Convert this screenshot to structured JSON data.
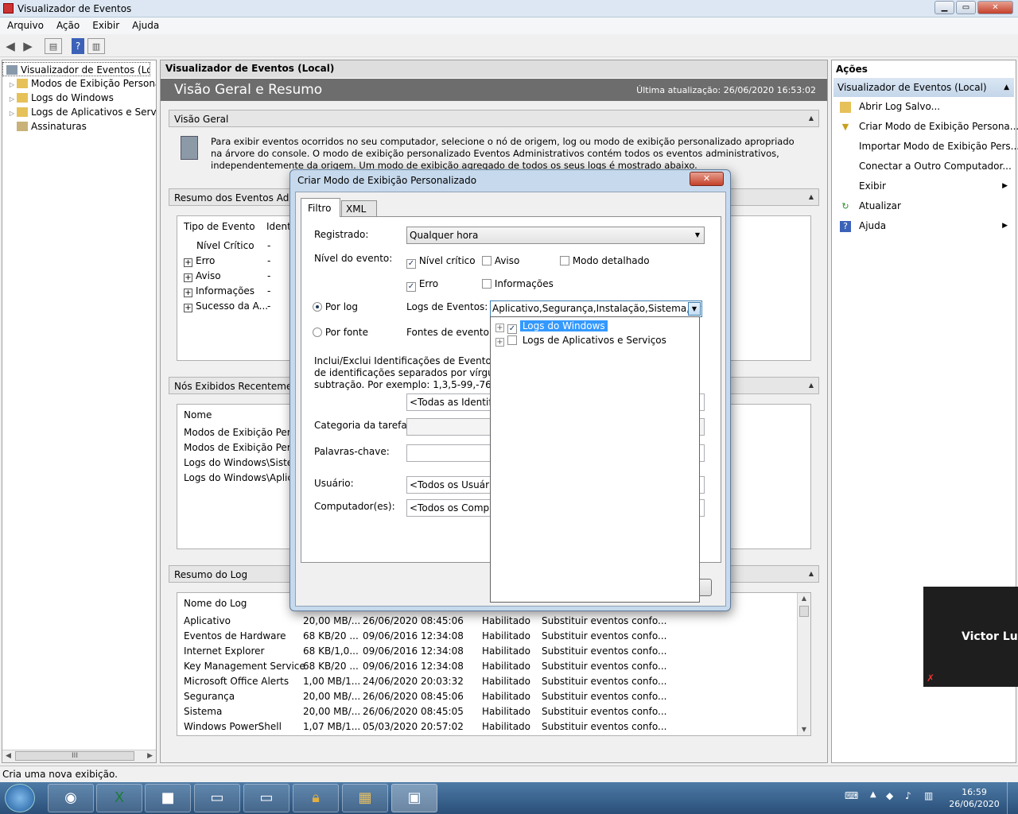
{
  "window": {
    "title": "Visualizador de Eventos"
  },
  "menu": [
    "Arquivo",
    "Ação",
    "Exibir",
    "Ajuda"
  ],
  "tree": {
    "root": "Visualizador de Eventos (Local)",
    "items": [
      "Modos de Exibição Personali",
      "Logs do Windows",
      "Logs de Aplicativos e Serviço",
      "Assinaturas"
    ]
  },
  "center": {
    "header": "Visualizador de Eventos (Local)",
    "overview_title": "Visão Geral e Resumo",
    "last_update": "Última atualização: 26/06/2020 16:53:02",
    "visao_geral": {
      "title": "Visão Geral",
      "text": "Para exibir eventos ocorridos no seu computador, selecione o nó de origem, log ou modo de exibição personalizado apropriado na árvore do console. O modo de exibição personalizado Eventos Administrativos contém todos os eventos administrativos, independentemente da origem. Um modo de exibição agregado de todos os seus logs é mostrado abaixo."
    },
    "resumo": {
      "title": "Resumo dos Eventos Admin",
      "col1": "Tipo de Evento",
      "col2": "Identi",
      "rows": [
        "Nível Crítico",
        "Erro",
        "Aviso",
        "Informações",
        "Sucesso da A..."
      ],
      "dash": "-"
    },
    "recentes": {
      "title": "Nós Exibidos Recentemente",
      "col": "Nome",
      "rows": [
        "Modos de Exibição Perso...",
        "Modos de Exibição Perso...",
        "Logs do Windows\\Sistem",
        "Logs do Windows\\Aplica"
      ]
    },
    "resumo_log": {
      "title": "Resumo do Log",
      "col": "Nome do Log",
      "rows": [
        [
          "Aplicativo",
          "20,00 MB/...",
          "26/06/2020 08:45:06",
          "Habilitado",
          "Substituir eventos confo..."
        ],
        [
          "Eventos de Hardware",
          "68 KB/20 ...",
          "09/06/2016 12:34:08",
          "Habilitado",
          "Substituir eventos confo..."
        ],
        [
          "Internet Explorer",
          "68 KB/1,0...",
          "09/06/2016 12:34:08",
          "Habilitado",
          "Substituir eventos confo..."
        ],
        [
          "Key Management Service",
          "68 KB/20 ...",
          "09/06/2016 12:34:08",
          "Habilitado",
          "Substituir eventos confo..."
        ],
        [
          "Microsoft Office Alerts",
          "1,00 MB/1...",
          "24/06/2020 20:03:32",
          "Habilitado",
          "Substituir eventos confo..."
        ],
        [
          "Segurança",
          "20,00 MB/...",
          "26/06/2020 08:45:06",
          "Habilitado",
          "Substituir eventos confo..."
        ],
        [
          "Sistema",
          "20,00 MB/...",
          "26/06/2020 08:45:05",
          "Habilitado",
          "Substituir eventos confo..."
        ],
        [
          "Windows PowerShell",
          "1,07 MB/1...",
          "05/03/2020 20:57:02",
          "Habilitado",
          "Substituir eventos confo..."
        ]
      ]
    }
  },
  "actions": {
    "title": "Ações",
    "section": "Visualizador de Eventos (Local)",
    "items": [
      "Abrir Log Salvo...",
      "Criar Modo de Exibição Persona...",
      "Importar Modo de Exibição Pers...",
      "Conectar a Outro Computador...",
      "Exibir",
      "Atualizar",
      "Ajuda"
    ]
  },
  "dialog": {
    "title": "Criar Modo de Exibição Personalizado",
    "tabs": [
      "Filtro",
      "XML"
    ],
    "registrado_label": "Registrado:",
    "registrado_value": "Qualquer hora",
    "nivel_label": "Nível do evento:",
    "nivel_critico": "Nível crítico",
    "aviso": "Aviso",
    "modo_detalhado": "Modo detalhado",
    "erro": "Erro",
    "informacoes": "Informações",
    "por_log": "Por log",
    "por_fonte": "Por fonte",
    "logs_label": "Logs de Eventos:",
    "logs_value": "Aplicativo,Segurança,Instalação,Sistema,Evento",
    "fontes_label": "Fontes de evento:",
    "ids_text1": "Inclui/Exclui Identificações de Evento: insira",
    "ids_text2": "de identificações separados por vírgulas. P",
    "ids_text3": "subtração. Por exemplo: 1,3,5-99,-76",
    "ids_value": "<Todas as Identifica",
    "categoria_label": "Categoria da tarefa:",
    "palavras_label": "Palavras-chave:",
    "usuario_label": "Usuário:",
    "usuario_value": "<Todos os Usuários",
    "computador_label": "Computador(es):",
    "computador_value": "<Todos os Comput",
    "dropdown": [
      "Logs do Windows",
      "Logs de Aplicativos e Serviços"
    ]
  },
  "status": "Cria uma nova exibição.",
  "video": {
    "name": "Victor Luiz"
  },
  "clock": {
    "time": "16:59",
    "date": "26/06/2020"
  }
}
